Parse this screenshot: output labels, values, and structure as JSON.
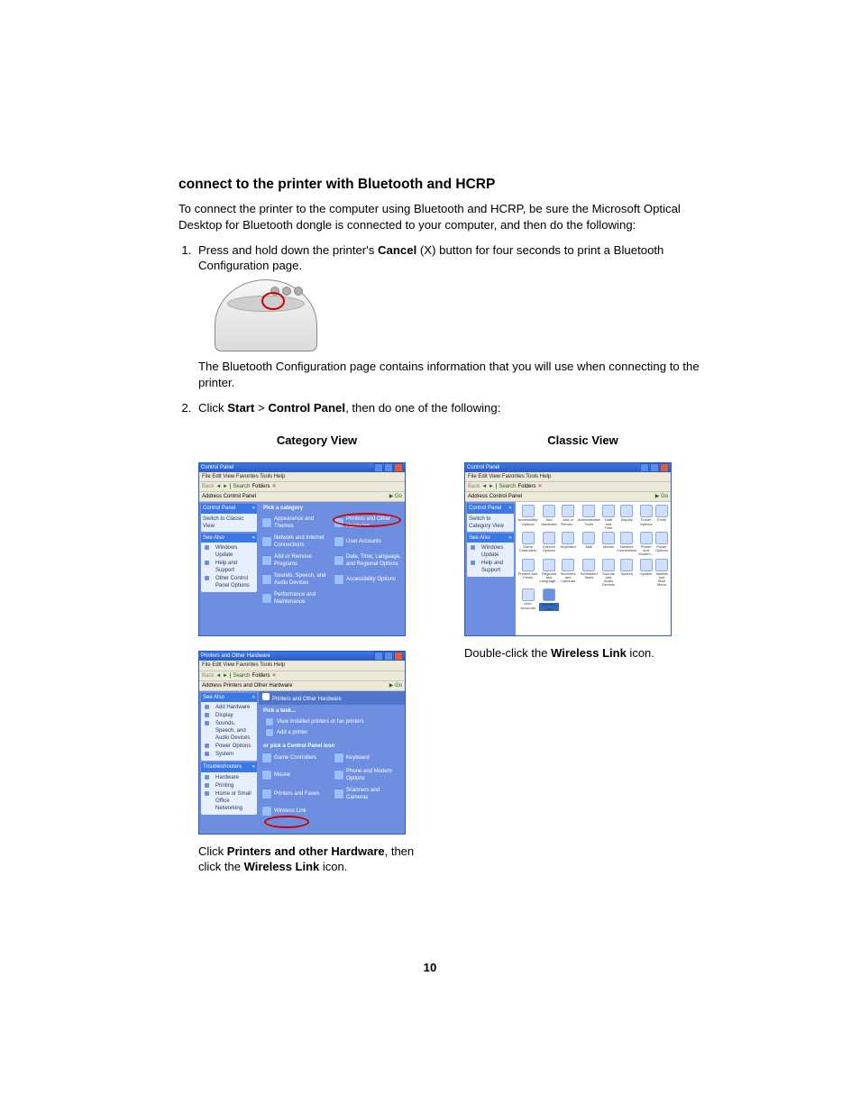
{
  "heading": "connect to the printer with Bluetooth and HCRP",
  "intro": "To connect the printer to the computer using Bluetooth and HCRP, be sure the Microsoft Optical Desktop for Bluetooth dongle is connected to your computer, and then do the following:",
  "step1_pre": "Press and hold down the printer's ",
  "step1_bold": "Cancel",
  "step1_post": " (X) button for four seconds to print a Bluetooth Configuration page.",
  "step1_note": "The Bluetooth Configuration page contains information that you will use when connecting to the printer.",
  "step2_pre": "Click ",
  "step2_b1": "Start",
  "step2_sep": " > ",
  "step2_b2": "Control Panel",
  "step2_post": ", then do one of the following:",
  "col1_head": "Category View",
  "col2_head": "Classic View",
  "xp": {
    "title": "Control Panel",
    "menu": "File   Edit   View   Favorites   Tools   Help",
    "back": "Back",
    "search": "Search",
    "folders": "Folders",
    "address_label": "Address",
    "address_value": "Control Panel",
    "go": "Go",
    "side_cp_title": "Control Panel",
    "side_switch": "Switch to Classic View",
    "side_seealso": "See Also",
    "see1": "Windows Update",
    "see2": "Help and Support",
    "see3": "Other Control Panel Options",
    "pick_cat": "Pick a category",
    "cats": [
      "Appearance and Themes",
      "Printers and Other Hardware",
      "Network and Internet Connections",
      "User Accounts",
      "Add or Remove Programs",
      "Date, Time, Language, and Regional Options",
      "Sounds, Speech, and Audio Devices",
      "Accessibility Options",
      "Performance and Maintenance"
    ]
  },
  "xp2": {
    "title": "Printers and Other Hardware",
    "address_value": "Printers and Other Hardware",
    "hdr1": "Printers and Other Hardware",
    "pick_task": "Pick a task...",
    "task1": "View installed printers or fax printers",
    "task2": "Add a printer",
    "or_pick": "or pick a Control Panel icon",
    "icons": [
      "Game Controllers",
      "Keyboard",
      "Mouse",
      "Phone and Modem Options",
      "Printers and Faxes",
      "Scanners and Cameras",
      "Wireless Link"
    ],
    "side_seealso": "See Also",
    "sa": [
      "Add Hardware",
      "Display",
      "Sounds, Speech, and Audio Devices",
      "Power Options",
      "System"
    ],
    "side_trouble": "Troubleshooters",
    "ts": [
      "Hardware",
      "Printing",
      "Home or Small Office Networking"
    ]
  },
  "classic": {
    "side_switch": "Switch to Category View",
    "icons": [
      "Accessibility Options",
      "Add Hardware",
      "Add or Remov...",
      "Administrative Tools",
      "Date and Time",
      "Display",
      "Folder Options",
      "Fonts",
      "Game Controllers",
      "Internet Options",
      "Keyboard",
      "Mail",
      "Mouse",
      "Network Connections",
      "Phone and Modem...",
      "Power Options",
      "Printers and Faxes",
      "Regional and Language...",
      "Scanners and Cameras",
      "Scheduled Tasks",
      "Sounds and Audio Devices",
      "Speech",
      "System",
      "Taskbar and Start Menu",
      "User Accounts",
      "Wireless Link"
    ]
  },
  "cap1_pre": "Click ",
  "cap1_b1": "Printers and other Hardware",
  "cap1_mid": ", then click the ",
  "cap1_b2": "Wireless Link",
  "cap1_post": " icon.",
  "cap2_pre": "Double-click the ",
  "cap2_b": "Wireless Link",
  "cap2_post": " icon.",
  "page_num": "10"
}
